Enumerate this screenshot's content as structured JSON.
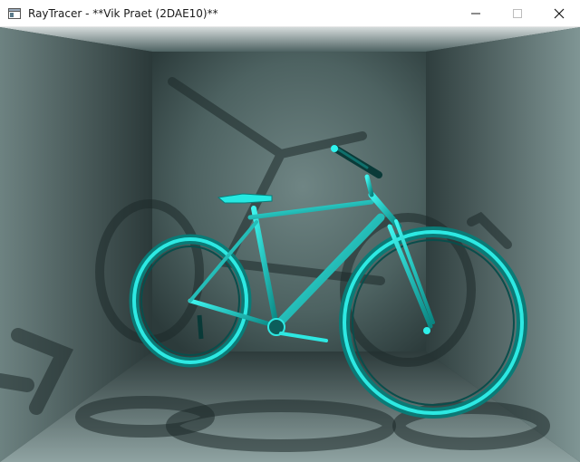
{
  "window": {
    "title": "RayTracer - **Vik Praet (2DAE10)**",
    "controls": {
      "minimize_icon": "minimize-icon",
      "maximize_icon": "maximize-icon",
      "close_icon": "close-icon"
    },
    "app_icon": "window-app-icon"
  },
  "scene": {
    "subject": "bicycle",
    "colors": {
      "bike": "#19e6e0",
      "bike_dark": "#0a6b68",
      "room_light": "#7c9392",
      "room_dark": "#1f2b2b",
      "shadow": "#101818"
    }
  }
}
